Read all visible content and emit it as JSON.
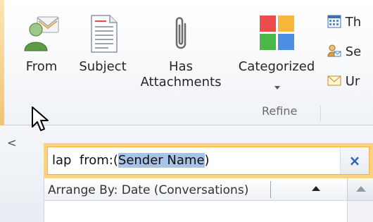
{
  "ribbon": {
    "buttons": {
      "from": {
        "label": "From"
      },
      "subject": {
        "label": "Subject"
      },
      "has_attachments": {
        "line1": "Has",
        "line2": "Attachments"
      },
      "categorized": {
        "label": "Categorized"
      }
    },
    "right_column": [
      {
        "label": "Th",
        "icon": "calendar-icon"
      },
      {
        "label": "Se",
        "icon": "sent-to-icon"
      },
      {
        "label": "Ur",
        "icon": "unread-envelope-icon"
      }
    ],
    "group_label": "Refine"
  },
  "pane": {
    "collapse_glyph": "<",
    "search": {
      "prefix": "lap  from:(",
      "selected": "Sender Name",
      "suffix": ")",
      "clear_glyph": "×"
    },
    "arrange_by": "Arrange By: Date (Conversations)"
  },
  "colors": {
    "search_border": "#fbd280",
    "selection": "#a9c3e6",
    "clear_icon": "#2b63b0",
    "category_red": "#ee4c4c",
    "category_orange": "#f7b53a",
    "category_green": "#49b849",
    "category_blue": "#4b8fe2"
  }
}
